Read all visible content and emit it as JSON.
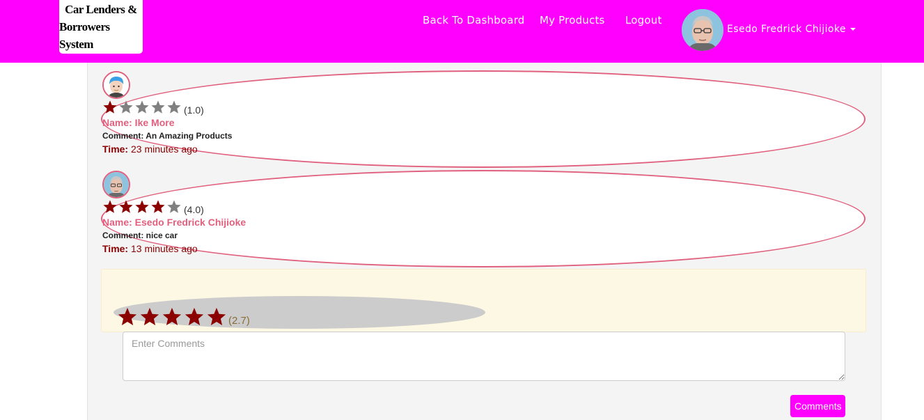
{
  "brand": {
    "line1": "Car Lenders &",
    "line2": "Borrowers System"
  },
  "nav": {
    "links": [
      "Back To Dashboard",
      "My Products",
      "Logout"
    ],
    "user_name": "Esedo Fredrick Chijioke"
  },
  "colors": {
    "navbar": "#ff00ff",
    "review_border": "#e0607e",
    "star_filled": "#8b0000",
    "star_empty": "#808080"
  },
  "reviews": [
    {
      "rating": 1,
      "rating_text": "(1.0)",
      "name": "Name: Ike More",
      "comment": "Comment: An Amazing Products",
      "time_label": "Time:",
      "time": "23 minutes ago",
      "avatar": "avatar-blue-hair-icon"
    },
    {
      "rating": 4,
      "rating_text": "(4.0)",
      "name": "Name: Esedo Fredrick Chijioke",
      "comment": "Comment: nice car",
      "time_label": "Time:",
      "time": "13 minutes ago",
      "avatar": "avatar-glasses-man-icon"
    }
  ],
  "rating_input": {
    "stars": 5,
    "average_text": "(2.7)"
  },
  "comment_form": {
    "placeholder": "Enter Comments",
    "value": "",
    "submit_label": "Comments"
  }
}
